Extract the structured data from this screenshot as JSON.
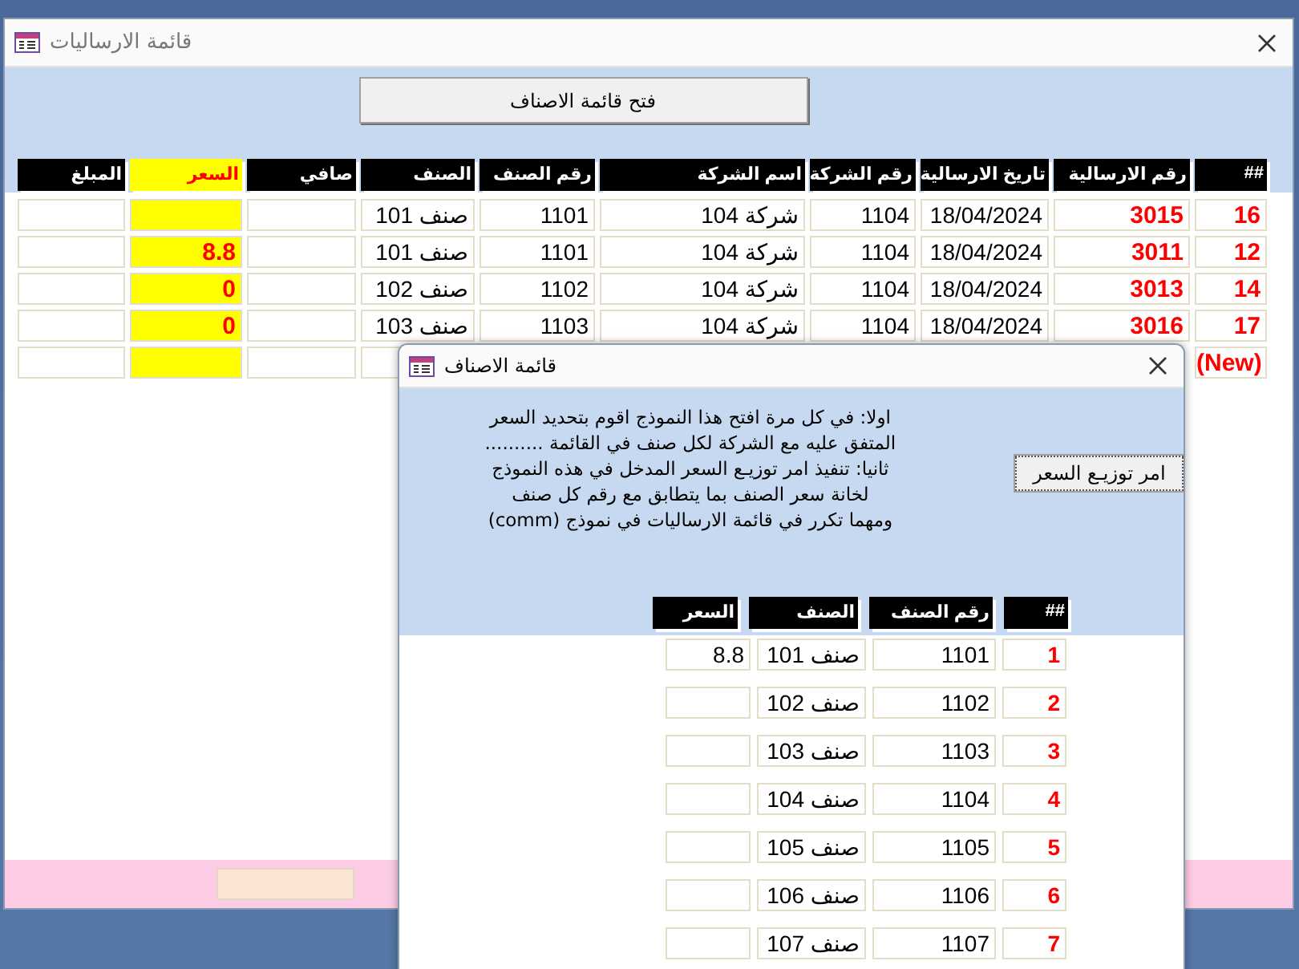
{
  "main_window": {
    "title": "قائمة الارساليات",
    "open_button": "فتح قائمة الاصناف",
    "columns": [
      {
        "label": "##",
        "kind": "red"
      },
      {
        "label": "رقم الارسالية",
        "kind": "red"
      },
      {
        "label": "تاريخ الارسالية",
        "kind": "plain"
      },
      {
        "label": "رقم الشركة",
        "kind": "plain"
      },
      {
        "label": "اسم الشركة",
        "kind": "plain"
      },
      {
        "label": "رقم الصنف",
        "kind": "plain"
      },
      {
        "label": "الصنف",
        "kind": "plain"
      },
      {
        "label": "صافي",
        "kind": "plain"
      },
      {
        "label": "السعر",
        "kind": "price"
      },
      {
        "label": "المبلغ",
        "kind": "plain"
      }
    ],
    "rows": [
      [
        "16",
        "3015",
        "18/04/2024",
        "1104",
        "شركة 104",
        "1101",
        "صنف 101",
        "",
        "",
        ""
      ],
      [
        "12",
        "3011",
        "18/04/2024",
        "1104",
        "شركة 104",
        "1101",
        "صنف 101",
        "",
        "8.8",
        ""
      ],
      [
        "14",
        "3013",
        "18/04/2024",
        "1104",
        "شركة 104",
        "1102",
        "صنف 102",
        "",
        "0",
        ""
      ],
      [
        "17",
        "3016",
        "18/04/2024",
        "1104",
        "شركة 104",
        "1103",
        "صنف 103",
        "",
        "0",
        ""
      ]
    ],
    "new_row": {
      "label": "(New)"
    }
  },
  "popup_window": {
    "title": "قائمة الاصناف",
    "instructions": [
      "اولا: في كل مرة افتح هذا النموذج اقوم بتحديد السعر",
      "المتفق عليه مع الشركة  لكل صنف في القائمة ..........",
      "ثانيا: تنفيذ امر توزيـع السعر المدخل في هذه النموذج",
      "لخانة سعر الصنف  بما يتطابق مع رقم كل صنف",
      "ومهما تكرر  في قائمة الارساليات في نموذج (comm)"
    ],
    "distribute_button": "امر توزيـع السعر",
    "columns": [
      {
        "label": "##",
        "kind": "red"
      },
      {
        "label": "رقم الصنف",
        "kind": "plain"
      },
      {
        "label": "الصنف",
        "kind": "plain"
      },
      {
        "label": "السعر",
        "kind": "plain"
      }
    ],
    "rows": [
      [
        "1",
        "1101",
        "صنف 101",
        "8.8"
      ],
      [
        "2",
        "1102",
        "صنف 102",
        ""
      ],
      [
        "3",
        "1103",
        "صنف 103",
        ""
      ],
      [
        "4",
        "1104",
        "صنف 104",
        ""
      ],
      [
        "5",
        "1105",
        "صنف 105",
        ""
      ],
      [
        "6",
        "1106",
        "صنف 106",
        ""
      ],
      [
        "7",
        "1107",
        "صنف 107",
        ""
      ]
    ]
  }
}
